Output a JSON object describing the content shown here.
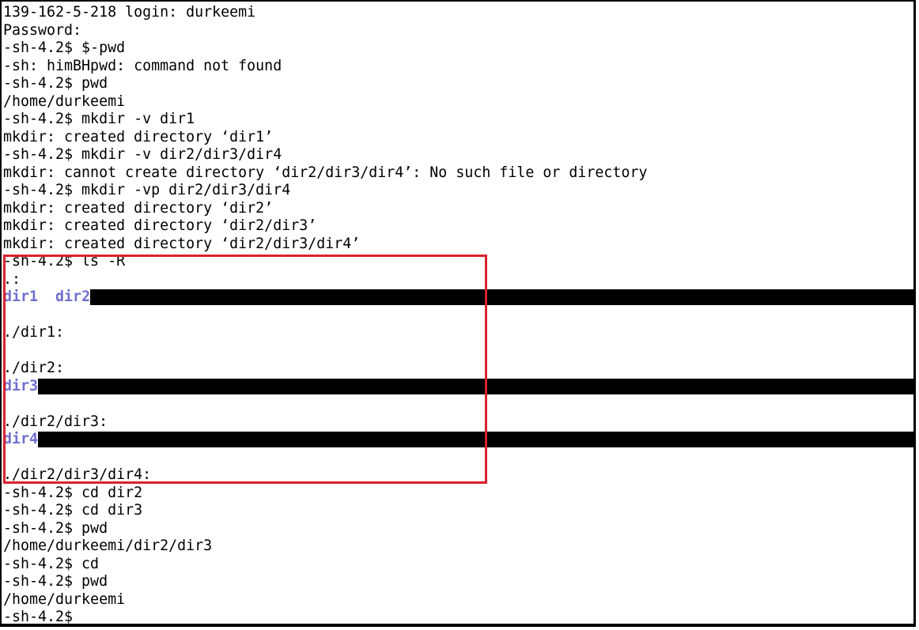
{
  "terminal": {
    "lines": [
      {
        "segments": [
          {
            "text": "139-162-5-218 login: durkeemi",
            "type": "text"
          }
        ]
      },
      {
        "segments": [
          {
            "text": "Password:",
            "type": "text"
          }
        ]
      },
      {
        "segments": [
          {
            "text": "-sh-4.2$ $-pwd",
            "type": "text"
          }
        ]
      },
      {
        "segments": [
          {
            "text": "-sh: himBHpwd: command not found",
            "type": "text"
          }
        ]
      },
      {
        "segments": [
          {
            "text": "-sh-4.2$ pwd",
            "type": "text"
          }
        ]
      },
      {
        "segments": [
          {
            "text": "/home/durkeemi",
            "type": "text"
          }
        ]
      },
      {
        "segments": [
          {
            "text": "-sh-4.2$ mkdir -v dir1",
            "type": "text"
          }
        ]
      },
      {
        "segments": [
          {
            "text": "mkdir: created directory ‘dir1’",
            "type": "text"
          }
        ]
      },
      {
        "segments": [
          {
            "text": "-sh-4.2$ mkdir -v dir2/dir3/dir4",
            "type": "text"
          }
        ]
      },
      {
        "segments": [
          {
            "text": "mkdir: cannot create directory ‘dir2/dir3/dir4’: No such file or directory",
            "type": "text"
          }
        ]
      },
      {
        "segments": [
          {
            "text": "-sh-4.2$ mkdir -vp dir2/dir3/dir4",
            "type": "text"
          }
        ]
      },
      {
        "segments": [
          {
            "text": "mkdir: created directory ‘dir2’",
            "type": "text"
          }
        ]
      },
      {
        "segments": [
          {
            "text": "mkdir: created directory ‘dir2/dir3’",
            "type": "text"
          }
        ]
      },
      {
        "segments": [
          {
            "text": "mkdir: created directory ‘dir2/dir3/dir4’",
            "type": "text"
          }
        ]
      },
      {
        "segments": [
          {
            "text": "-sh-4.2$ ls -R",
            "type": "text"
          }
        ]
      },
      {
        "segments": [
          {
            "text": ".:",
            "type": "text"
          }
        ]
      },
      {
        "segments": [
          {
            "text": "dir1",
            "type": "dir"
          },
          {
            "text": "  ",
            "type": "text"
          },
          {
            "text": "dir2",
            "type": "dir"
          }
        ],
        "bar": true
      },
      {
        "segments": [
          {
            "text": "",
            "type": "text"
          }
        ]
      },
      {
        "segments": [
          {
            "text": "./dir1:",
            "type": "text"
          }
        ]
      },
      {
        "segments": [
          {
            "text": "",
            "type": "text"
          }
        ]
      },
      {
        "segments": [
          {
            "text": "./dir2:",
            "type": "text"
          }
        ]
      },
      {
        "segments": [
          {
            "text": "dir3",
            "type": "dir"
          }
        ],
        "bar": true
      },
      {
        "segments": [
          {
            "text": "",
            "type": "text"
          }
        ]
      },
      {
        "segments": [
          {
            "text": "./dir2/dir3:",
            "type": "text"
          }
        ]
      },
      {
        "segments": [
          {
            "text": "dir4",
            "type": "dir"
          }
        ],
        "bar": true
      },
      {
        "segments": [
          {
            "text": "",
            "type": "text"
          }
        ]
      },
      {
        "segments": [
          {
            "text": "./dir2/dir3/dir4:",
            "type": "text"
          }
        ]
      },
      {
        "segments": [
          {
            "text": "-sh-4.2$ cd dir2",
            "type": "text"
          }
        ]
      },
      {
        "segments": [
          {
            "text": "-sh-4.2$ cd dir3",
            "type": "text"
          }
        ]
      },
      {
        "segments": [
          {
            "text": "-sh-4.2$ pwd",
            "type": "text"
          }
        ]
      },
      {
        "segments": [
          {
            "text": "/home/durkeemi/dir2/dir3",
            "type": "text"
          }
        ]
      },
      {
        "segments": [
          {
            "text": "-sh-4.2$ cd",
            "type": "text"
          }
        ]
      },
      {
        "segments": [
          {
            "text": "-sh-4.2$ pwd",
            "type": "text"
          }
        ]
      },
      {
        "segments": [
          {
            "text": "/home/durkeemi",
            "type": "text"
          }
        ]
      },
      {
        "segments": [
          {
            "text": "-sh-4.2$",
            "type": "text"
          }
        ]
      }
    ]
  },
  "colors": {
    "background": "#ffffff",
    "text": "#000000",
    "directory": "#6f6fcf",
    "highlight_box": "#d9232d"
  }
}
